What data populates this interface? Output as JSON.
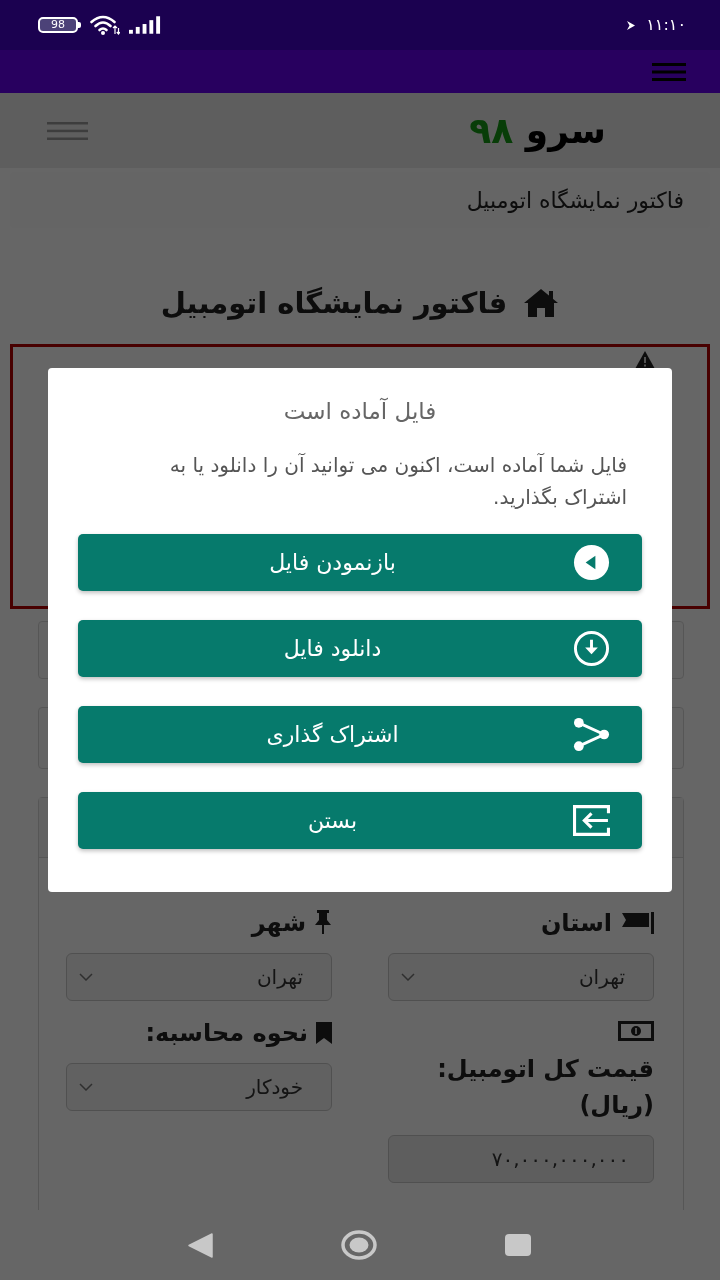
{
  "status_bar": {
    "battery": "98",
    "time": "۱۱:۱۰"
  },
  "header": {
    "logo": {
      "word": "سرو",
      "number": "۹۸"
    }
  },
  "breadcrumb": "فاکتور نمایشگاه اتومبیل",
  "page_title": "فاکتور نمایشگاه اتومبیل",
  "form": {
    "fields": [
      {
        "kind": "select",
        "label": "استان",
        "value": "تهران"
      },
      {
        "kind": "select",
        "label": "شهر",
        "value": "تهران"
      },
      {
        "kind": "text",
        "label": "قیمت کل اتومبیل: (ریال)",
        "value": "۷۰,۰۰۰,۰۰۰,۰۰۰"
      },
      {
        "kind": "select",
        "label": "نحوه محاسبه:",
        "value": "خودکار"
      }
    ]
  },
  "dialog": {
    "title": "فایل آماده است",
    "message": "فایل شما آماده است، اکنون می توانید آن را دانلود یا به اشتراک بگذارید.",
    "buttons": [
      "بازنمودن فایل",
      "دانلود فایل",
      "اشتراک گذاری",
      "بستن"
    ]
  }
}
